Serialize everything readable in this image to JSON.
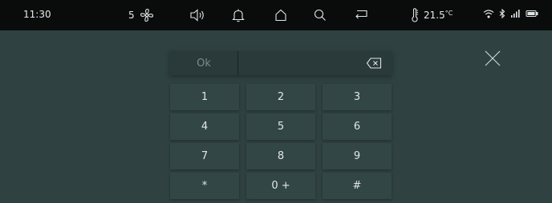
{
  "status_bar": {
    "time": "11:30",
    "fan_level": "5",
    "temperature": "21.5",
    "temperature_unit": "°C",
    "icons": [
      "fan-icon",
      "volume-icon",
      "bell-icon",
      "home-icon",
      "search-icon",
      "back-icon",
      "thermometer-icon",
      "wifi-icon",
      "bluetooth-icon",
      "signal-icon",
      "battery-icon"
    ]
  },
  "keypad": {
    "ok_label": "Ok",
    "entry_value": "",
    "keys": [
      "1",
      "2",
      "3",
      "4",
      "5",
      "6",
      "7",
      "8",
      "9",
      "*",
      "0 +",
      "#"
    ]
  },
  "colors": {
    "background": "#2f4141",
    "statusbar": "#0a0c0c",
    "key": "#334646",
    "text": "#e0e6e6"
  }
}
